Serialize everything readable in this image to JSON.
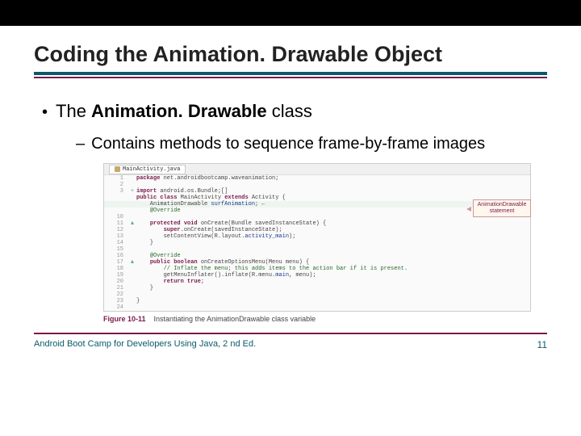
{
  "title": "Coding the Animation. Drawable Object",
  "bullet": {
    "lead": "The ",
    "bold": "Animation. Drawable",
    "tail": " class",
    "sub": "Contains methods to sequence frame-by-frame images"
  },
  "editor": {
    "tab_label": "MainActivity.java",
    "lines": [
      {
        "n": "1",
        "m": "",
        "cls": "",
        "html": "<span class='kw'>package</span> net.androidbootcamp.waveanimation;"
      },
      {
        "n": "2",
        "m": "",
        "cls": "",
        "html": ""
      },
      {
        "n": "3",
        "m": "+",
        "cls": "",
        "html": "<span class='kw'>import</span> android.os.Bundle;[]"
      },
      {
        "n": "",
        "m": "",
        "cls": "",
        "html": ""
      },
      {
        "n": "",
        "m": "",
        "cls": "",
        "html": "<span class='kw'>public class</span> MainActivity <span class='kw'>extends</span> Activity {"
      },
      {
        "n": "",
        "m": "",
        "cls": "hl5",
        "html": "    AnimationDrawable <span class='str'>surfAnimation</span>; &larr;"
      },
      {
        "n": "",
        "m": "",
        "cls": "",
        "html": "    <span class='cm'>@Override</span>"
      },
      {
        "n": "10",
        "m": "",
        "cls": "",
        "html": ""
      },
      {
        "n": "11",
        "m": "▲",
        "cls": "",
        "html": "    <span class='kw'>protected void</span> onCreate(Bundle savedInstanceState) {"
      },
      {
        "n": "12",
        "m": "",
        "cls": "",
        "html": "        <span class='kw'>super</span>.onCreate(savedInstanceState);"
      },
      {
        "n": "13",
        "m": "",
        "cls": "",
        "html": "        setContentView(R.layout.<span class='str'>activity_main</span>);"
      },
      {
        "n": "14",
        "m": "",
        "cls": "",
        "html": "    }"
      },
      {
        "n": "15",
        "m": "",
        "cls": "",
        "html": ""
      },
      {
        "n": "16",
        "m": "",
        "cls": "",
        "html": "    <span class='cm'>@Override</span>"
      },
      {
        "n": "17",
        "m": "▲",
        "cls": "",
        "html": "    <span class='kw'>public boolean</span> onCreateOptionsMenu(Menu menu) {"
      },
      {
        "n": "18",
        "m": "",
        "cls": "",
        "html": "        <span class='cm'>// Inflate the menu; this adds items to the action bar if it is present.</span>"
      },
      {
        "n": "19",
        "m": "",
        "cls": "",
        "html": "        getMenuInflater().inflate(R.menu.<span class='str'>main</span>, menu);"
      },
      {
        "n": "20",
        "m": "",
        "cls": "",
        "html": "        <span class='kw'>return true</span>;"
      },
      {
        "n": "21",
        "m": "",
        "cls": "",
        "html": "    }"
      },
      {
        "n": "22",
        "m": "",
        "cls": "",
        "html": ""
      },
      {
        "n": "23",
        "m": "",
        "cls": "",
        "html": "}"
      },
      {
        "n": "24",
        "m": "",
        "cls": "",
        "html": ""
      }
    ],
    "callout": "AnimationDrawable statement"
  },
  "figure": {
    "label": "Figure 10-11",
    "caption": "Instantiating the AnimationDrawable class variable"
  },
  "footer": {
    "left": "Android Boot Camp for Developers Using Java, 2 nd Ed.",
    "page": "11"
  }
}
